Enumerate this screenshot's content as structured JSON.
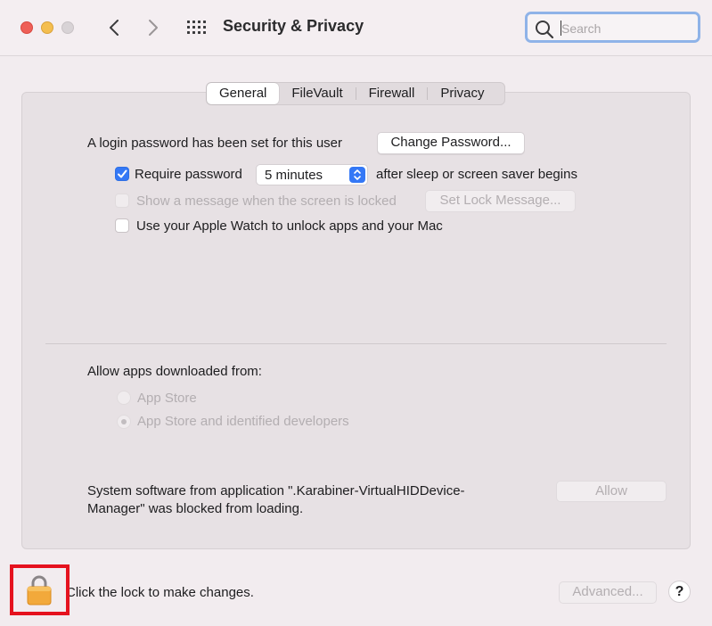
{
  "window": {
    "title": "Security & Privacy",
    "search_placeholder": "Search"
  },
  "tabs": [
    {
      "label": "General",
      "active": true
    },
    {
      "label": "FileVault",
      "active": false
    },
    {
      "label": "Firewall",
      "active": false
    },
    {
      "label": "Privacy",
      "active": false
    }
  ],
  "general": {
    "login_text": "A login password has been set for this user",
    "change_password_label": "Change Password...",
    "require_password": {
      "label": "Require password",
      "checked": true
    },
    "require_interval": "5 minutes",
    "after_sleep_text": "after sleep or screen saver begins",
    "show_message": {
      "label": "Show a message when the screen is locked",
      "checked": false,
      "disabled": true
    },
    "set_lock_message_label": "Set Lock Message...",
    "apple_watch": {
      "label": "Use your Apple Watch to unlock apps and your Mac",
      "checked": false
    }
  },
  "downloads": {
    "heading": "Allow apps downloaded from:",
    "options": [
      {
        "label": "App Store",
        "selected": false
      },
      {
        "label": "App Store and identified developers",
        "selected": true
      }
    ]
  },
  "blocked": {
    "line1": "System software from application \".Karabiner-VirtualHIDDevice-",
    "line2": "Manager\" was blocked from loading.",
    "allow_label": "Allow"
  },
  "footer": {
    "lock_text": "Click the lock to make changes.",
    "advanced_label": "Advanced...",
    "help_label": "?"
  },
  "colors": {
    "accent": "#3478f6",
    "highlight": "#e5121e"
  }
}
